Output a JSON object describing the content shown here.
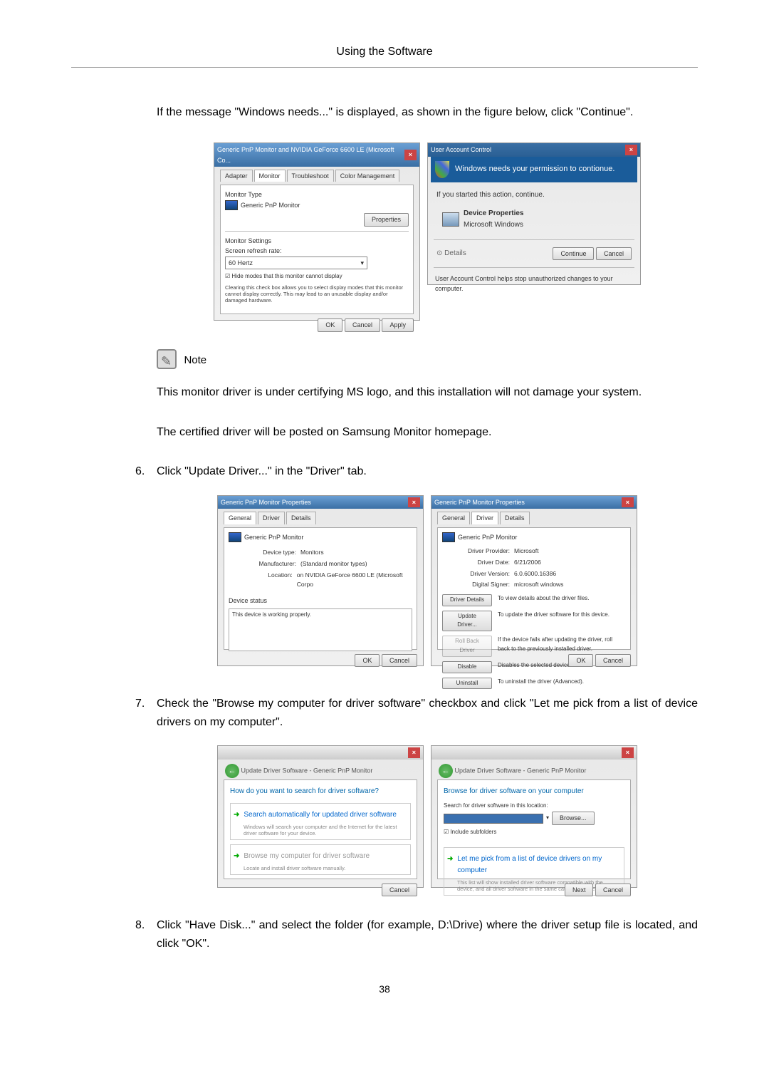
{
  "header": {
    "title": "Using the Software"
  },
  "intro_text": "If the message \"Windows needs...\" is displayed, as shown in the figure below, click \"Continue\".",
  "fig1": {
    "title": "Generic PnP Monitor and NVIDIA GeForce 6600 LE (Microsoft Co...",
    "tabs": [
      "Adapter",
      "Monitor",
      "Troubleshoot",
      "Color Management"
    ],
    "monitor_type_label": "Monitor Type",
    "monitor_name": "Generic PnP Monitor",
    "properties_btn": "Properties",
    "settings_label": "Monitor Settings",
    "refresh_label": "Screen refresh rate:",
    "refresh_value": "60 Hertz",
    "hide_checkbox": "Hide modes that this monitor cannot display",
    "hide_desc": "Clearing this check box allows you to select display modes that this monitor cannot display correctly. This may lead to an unusable display and/or damaged hardware.",
    "ok": "OK",
    "cancel": "Cancel",
    "apply": "Apply"
  },
  "fig2": {
    "title": "User Account Control",
    "band": "Windows needs your permission to contionue.",
    "action_label": "If you started this action, continue.",
    "prop_name": "Device Properties",
    "publisher": "Microsoft Windows",
    "details": "Details",
    "continue": "Continue",
    "cancel": "Cancel",
    "footer": "User Account Control helps stop unauthorized changes to your computer."
  },
  "note": {
    "label": "Note",
    "text1": "This monitor driver is under certifying MS logo, and this installation will not damage your system.",
    "text2": "The certified driver will be posted on Samsung Monitor homepage."
  },
  "step6": {
    "num": "6.",
    "text": "Click \"Update Driver...\" in the \"Driver\" tab."
  },
  "fig3": {
    "title": "Generic PnP Monitor Properties",
    "tabs": [
      "General",
      "Driver",
      "Details"
    ],
    "monitor_name": "Generic PnP Monitor",
    "device_type_label": "Device type:",
    "device_type": "Monitors",
    "manufacturer_label": "Manufacturer:",
    "manufacturer": "(Standard monitor types)",
    "location_label": "Location:",
    "location": "on NVIDIA GeForce 6600 LE (Microsoft Corpo",
    "status_label": "Device status",
    "status_text": "This device is working properly.",
    "ok": "OK",
    "cancel": "Cancel"
  },
  "fig4": {
    "title": "Generic PnP Monitor Properties",
    "tabs": [
      "General",
      "Driver",
      "Details"
    ],
    "monitor_name": "Generic PnP Monitor",
    "provider_label": "Driver Provider:",
    "provider": "Microsoft",
    "date_label": "Driver Date:",
    "date": "6/21/2006",
    "version_label": "Driver Version:",
    "version": "6.0.6000.16386",
    "signer_label": "Digital Signer:",
    "signer": "microsoft windows",
    "btn_details": "Driver Details",
    "desc_details": "To view details about the driver files.",
    "btn_update": "Update Driver...",
    "desc_update": "To update the driver software for this device.",
    "btn_rollback": "Roll Back Driver",
    "desc_rollback": "If the device fails after updating the driver, roll back to the previously installed driver.",
    "btn_disable": "Disable",
    "desc_disable": "Disables the selected device.",
    "btn_uninstall": "Uninstall",
    "desc_uninstall": "To uninstall the driver (Advanced).",
    "ok": "OK",
    "cancel": "Cancel"
  },
  "step7": {
    "num": "7.",
    "text": "Check the \"Browse my computer for driver software\" checkbox and click \"Let me pick from a list of device drivers on my computer\"."
  },
  "fig5": {
    "breadcrumb": "Update Driver Software - Generic PnP Monitor",
    "heading": "How do you want to search for driver software?",
    "opt1_title": "Search automatically for updated driver software",
    "opt1_desc": "Windows will search your computer and the Internet for the latest driver software for your device.",
    "opt2_title": "Browse my computer for driver software",
    "opt2_desc": "Locate and install driver software manually.",
    "cancel": "Cancel"
  },
  "fig6": {
    "breadcrumb": "Update Driver Software - Generic PnP Monitor",
    "heading": "Browse for driver software on your computer",
    "search_label": "Search for driver software in this location:",
    "browse": "Browse...",
    "include_sub": "Include subfolders",
    "opt_title": "Let me pick from a list of device drivers on my computer",
    "opt_desc": "This list will show installed driver software compatible with the device, and all driver software in the same category as the device.",
    "next": "Next",
    "cancel": "Cancel"
  },
  "step8": {
    "num": "8.",
    "text": "Click \"Have Disk...\" and select the folder (for example, D:\\Drive) where the driver setup file is located, and click \"OK\"."
  },
  "page_number": "38"
}
